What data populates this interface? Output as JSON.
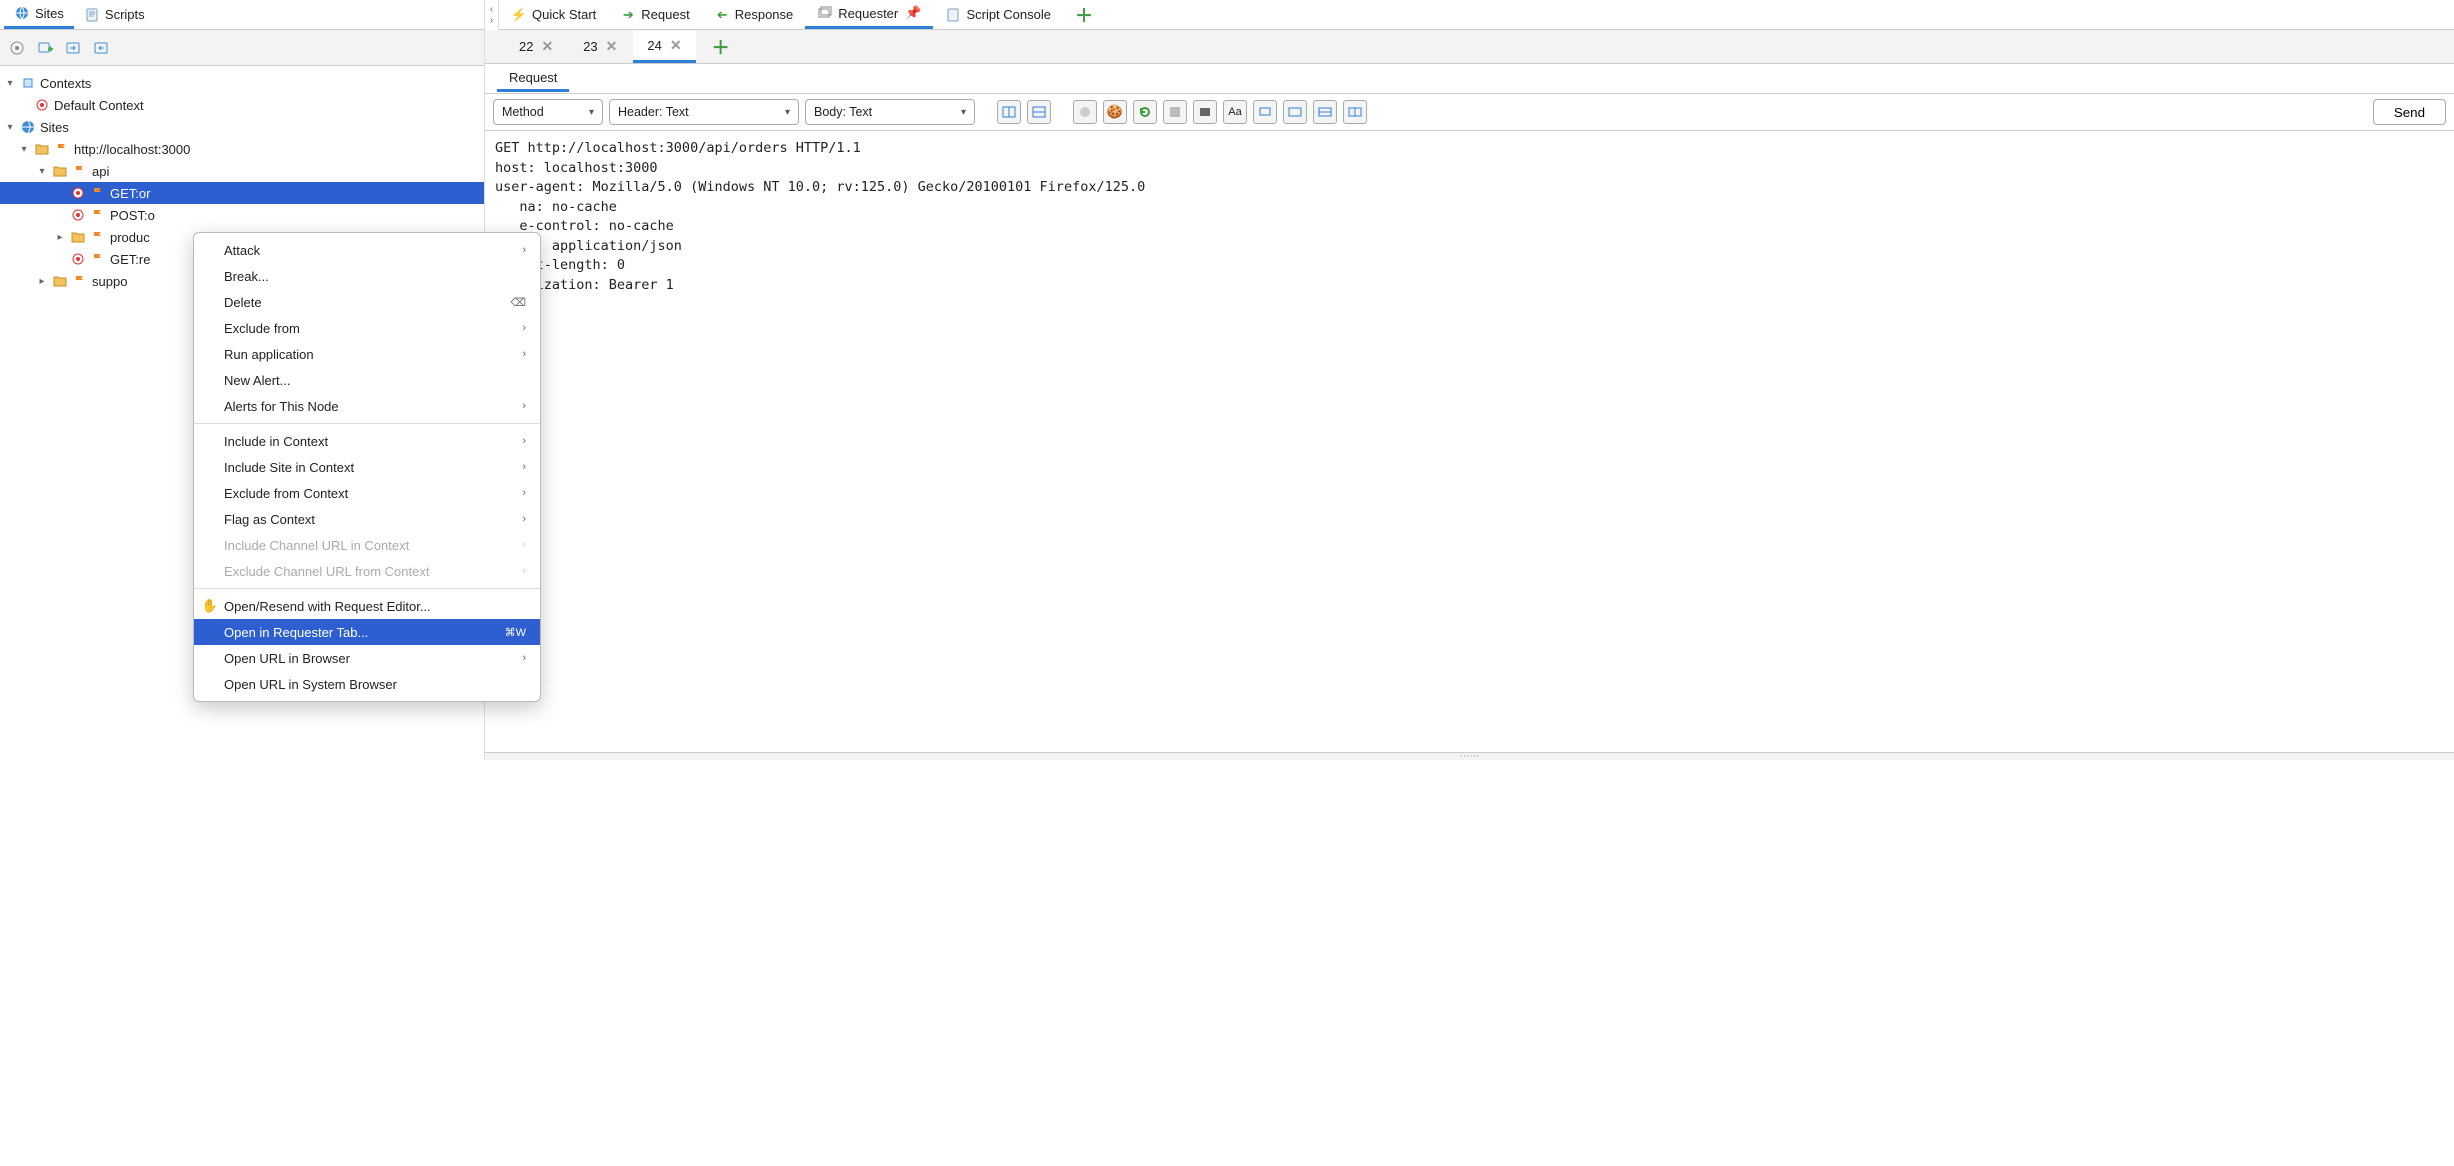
{
  "leftTabs": {
    "sites": "Sites",
    "scripts": "Scripts"
  },
  "tree": {
    "contexts": "Contexts",
    "defaultContext": "Default Context",
    "sitesRoot": "Sites",
    "host": "http://localhost:3000",
    "api": "api",
    "getOrders": "GET:or",
    "postO": "POST:o",
    "products": "produc",
    "getRe": "GET:re",
    "support": "suppo"
  },
  "rightTabs": {
    "quickStart": "Quick Start",
    "request": "Request",
    "response": "Response",
    "requester": "Requester",
    "scriptConsole": "Script Console"
  },
  "numTabs": {
    "t22": "22",
    "t23": "23",
    "t24": "24"
  },
  "subTab": "Request",
  "combos": {
    "method": "Method",
    "header": "Header: Text",
    "body": "Body: Text"
  },
  "sendBtn": "Send",
  "requestText": "GET http://localhost:3000/api/orders HTTP/1.1\nhost: localhost:3000\nuser-agent: Mozilla/5.0 (Windows NT 10.0; rv:125.0) Gecko/20100101 Firefox/125.0\n   na: no-cache\n   e-control: no-cache\n   ot: application/json\n   ent-length: 0\n   orization: Bearer 1",
  "ctx": {
    "attack": "Attack",
    "break": "Break...",
    "delete": "Delete",
    "excludeFrom": "Exclude from",
    "runApp": "Run application",
    "newAlert": "New Alert...",
    "alertsNode": "Alerts for This Node",
    "includeCtx": "Include in Context",
    "includeSite": "Include Site in Context",
    "excludeCtx": "Exclude from Context",
    "flagCtx": "Flag as Context",
    "incChan": "Include Channel URL in Context",
    "excChan": "Exclude Channel URL from Context",
    "openResend": "Open/Resend with Request Editor...",
    "openRequester": "Open in Requester Tab...",
    "openRequesterKey": "⌘W",
    "openUrl": "Open URL in Browser",
    "openUrlSys": "Open URL in System Browser"
  }
}
